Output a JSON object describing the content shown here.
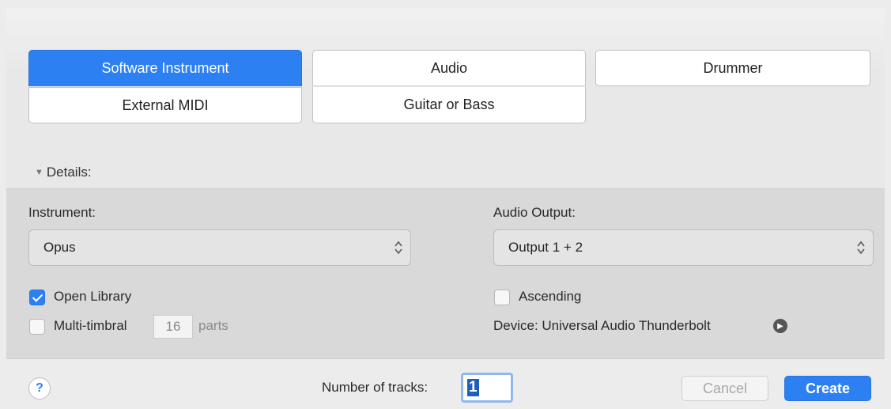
{
  "track_types": {
    "software_instrument": "Software Instrument",
    "audio": "Audio",
    "drummer": "Drummer",
    "external_midi": "External MIDI",
    "guitar_or_bass": "Guitar or Bass",
    "selected": "Software Instrument"
  },
  "details": {
    "toggle_label": "Details:",
    "instrument_label": "Instrument:",
    "instrument_value": "Opus",
    "audio_output_label": "Audio Output:",
    "audio_output_value": "Output 1 + 2",
    "open_library_label": "Open Library",
    "open_library_checked": true,
    "ascending_label": "Ascending",
    "ascending_checked": false,
    "multi_timbral_label": "Multi-timbral",
    "multi_timbral_checked": false,
    "multi_timbral_value": "16",
    "parts_label": "parts",
    "device_label": "Device: Universal Audio Thunderbolt"
  },
  "footer": {
    "help_label": "?",
    "tracks_label": "Number of tracks:",
    "tracks_value": "1",
    "cancel_label": "Cancel",
    "create_label": "Create"
  },
  "colors": {
    "accent": "#2d80f1",
    "panel": "#d9d9d9",
    "background": "#ececec"
  }
}
